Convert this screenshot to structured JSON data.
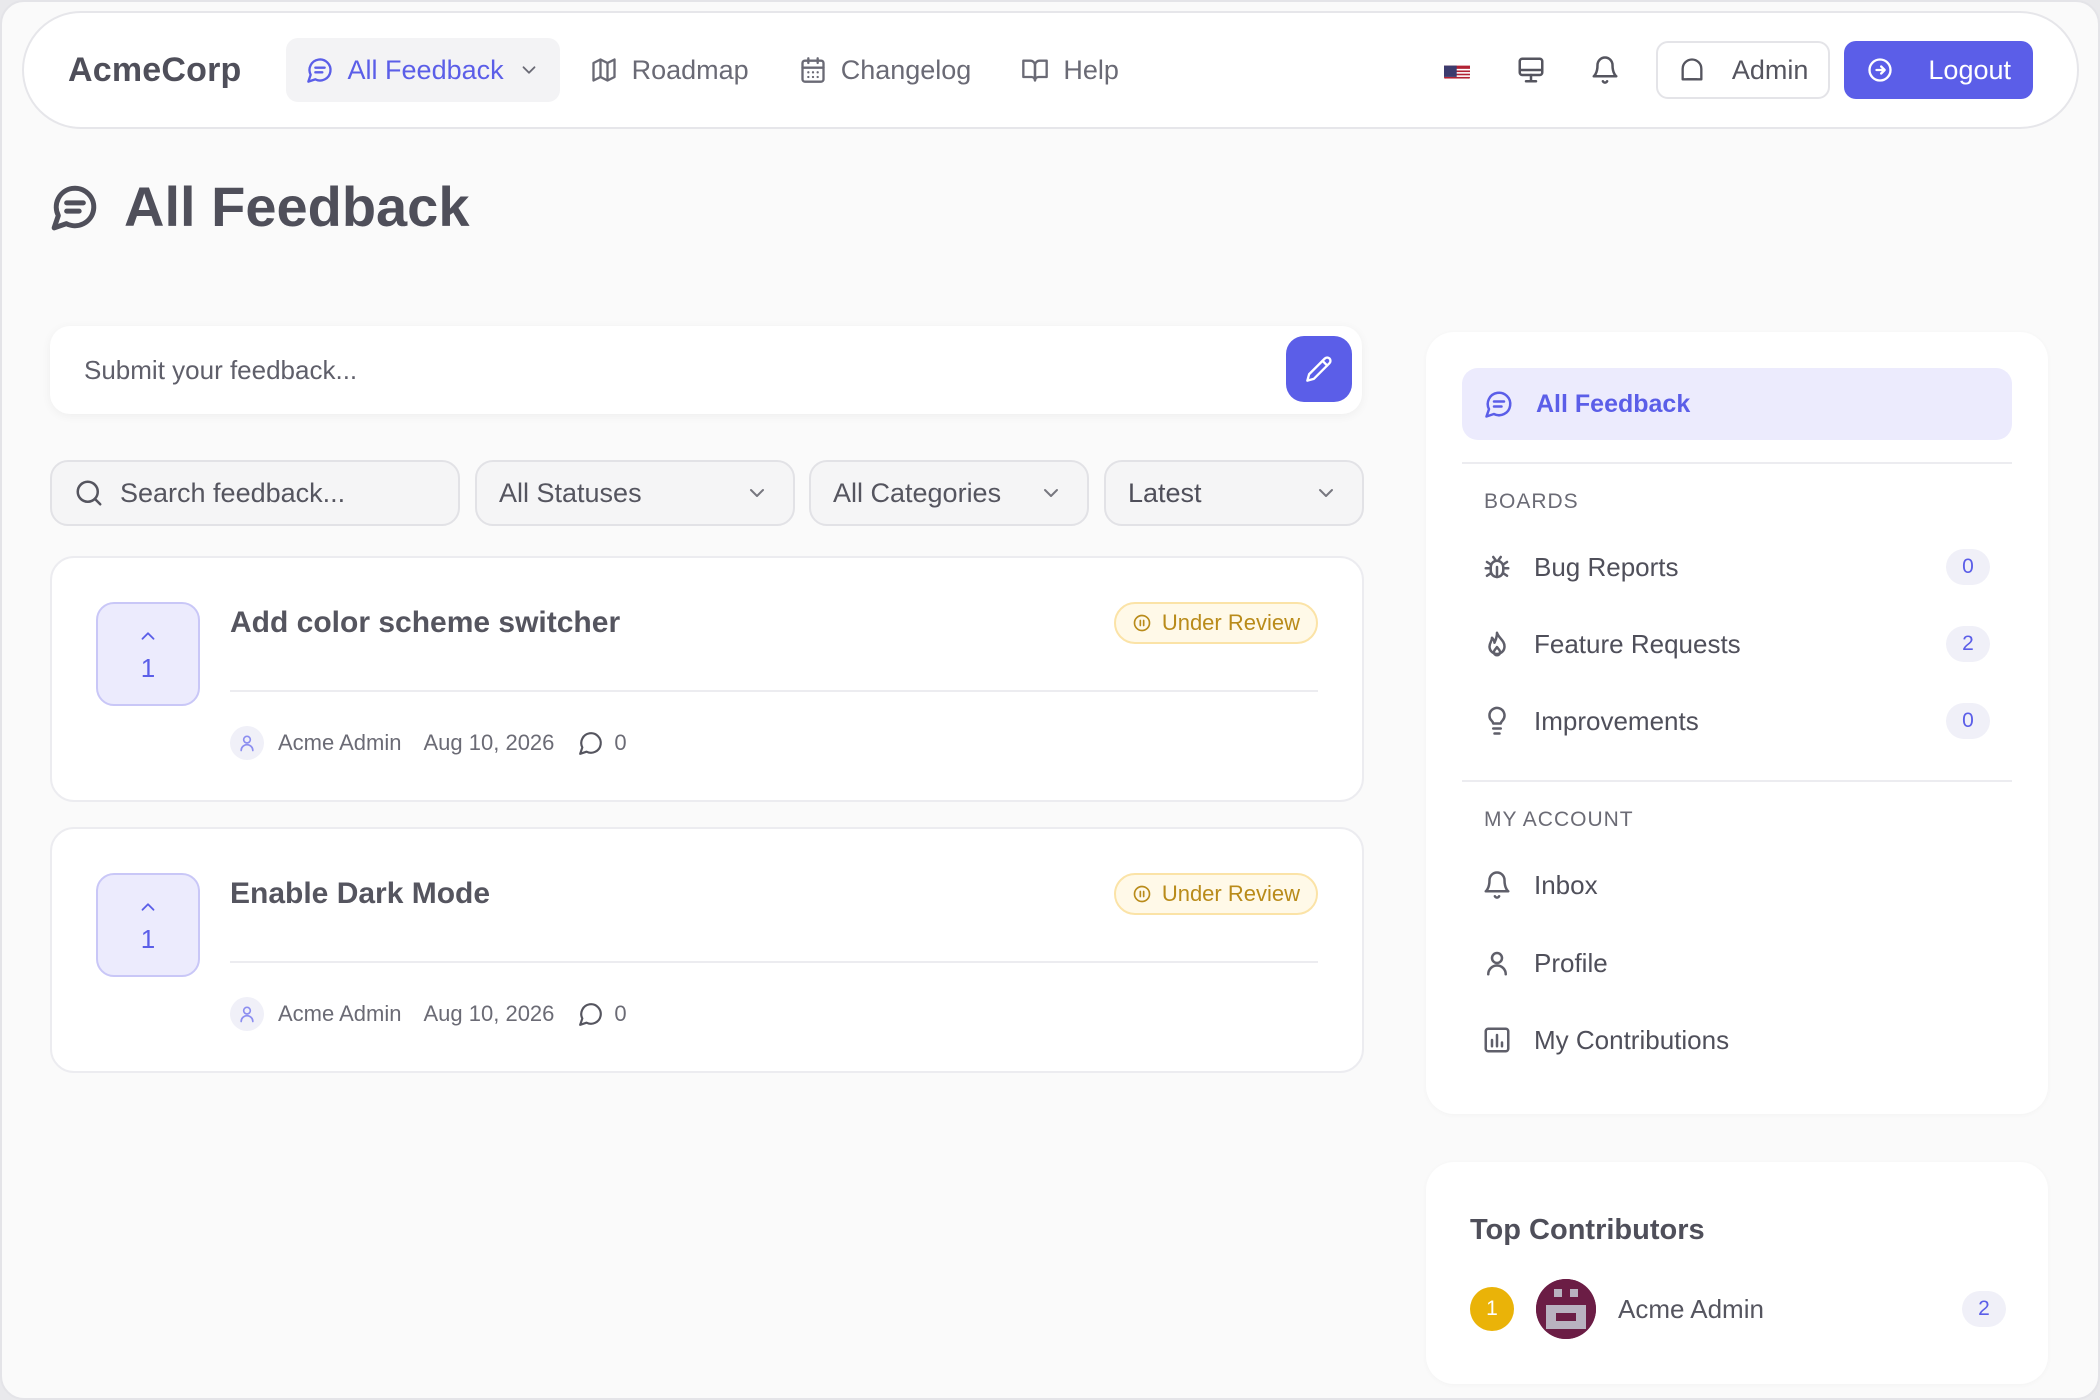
{
  "navbar": {
    "brand": "AcmeCorp",
    "items": [
      {
        "label": "All Feedback",
        "icon": "message-square-icon",
        "active": true
      },
      {
        "label": "Roadmap",
        "icon": "map-icon"
      },
      {
        "label": "Changelog",
        "icon": "calendar-icon"
      },
      {
        "label": "Help",
        "icon": "book-open-icon"
      }
    ],
    "admin_label": "Admin",
    "logout_label": "Logout"
  },
  "page": {
    "title": "All Feedback"
  },
  "submit": {
    "placeholder": "Submit your feedback..."
  },
  "filters": {
    "search_placeholder": "Search feedback...",
    "status": "All Statuses",
    "category": "All Categories",
    "sort": "Latest"
  },
  "posts": [
    {
      "votes": "1",
      "title": "Add color scheme switcher",
      "status": "Under Review",
      "author": "Acme Admin",
      "date": "Aug 10, 2026",
      "comments": "0"
    },
    {
      "votes": "1",
      "title": "Enable Dark Mode",
      "status": "Under Review",
      "author": "Acme Admin",
      "date": "Aug 10, 2026",
      "comments": "0"
    }
  ],
  "sidebar": {
    "active_label": "All Feedback",
    "boards_heading": "BOARDS",
    "boards": [
      {
        "label": "Bug Reports",
        "count": "0",
        "icon": "bug-icon"
      },
      {
        "label": "Feature Requests",
        "count": "2",
        "icon": "flame-icon"
      },
      {
        "label": "Improvements",
        "count": "0",
        "icon": "lightbulb-icon"
      }
    ],
    "account_heading": "MY ACCOUNT",
    "account": [
      {
        "label": "Inbox",
        "icon": "bell-icon"
      },
      {
        "label": "Profile",
        "icon": "user-icon"
      },
      {
        "label": "My Contributions",
        "icon": "bar-chart-icon"
      }
    ]
  },
  "contributors": {
    "title": "Top Contributors",
    "items": [
      {
        "rank": "1",
        "name": "Acme Admin",
        "count": "2"
      }
    ]
  },
  "colors": {
    "accent": "#5b5ee8",
    "status_under_review": "#b98b1a",
    "rank_gold": "#eab308",
    "avatar_bg": "#6b1d45"
  }
}
